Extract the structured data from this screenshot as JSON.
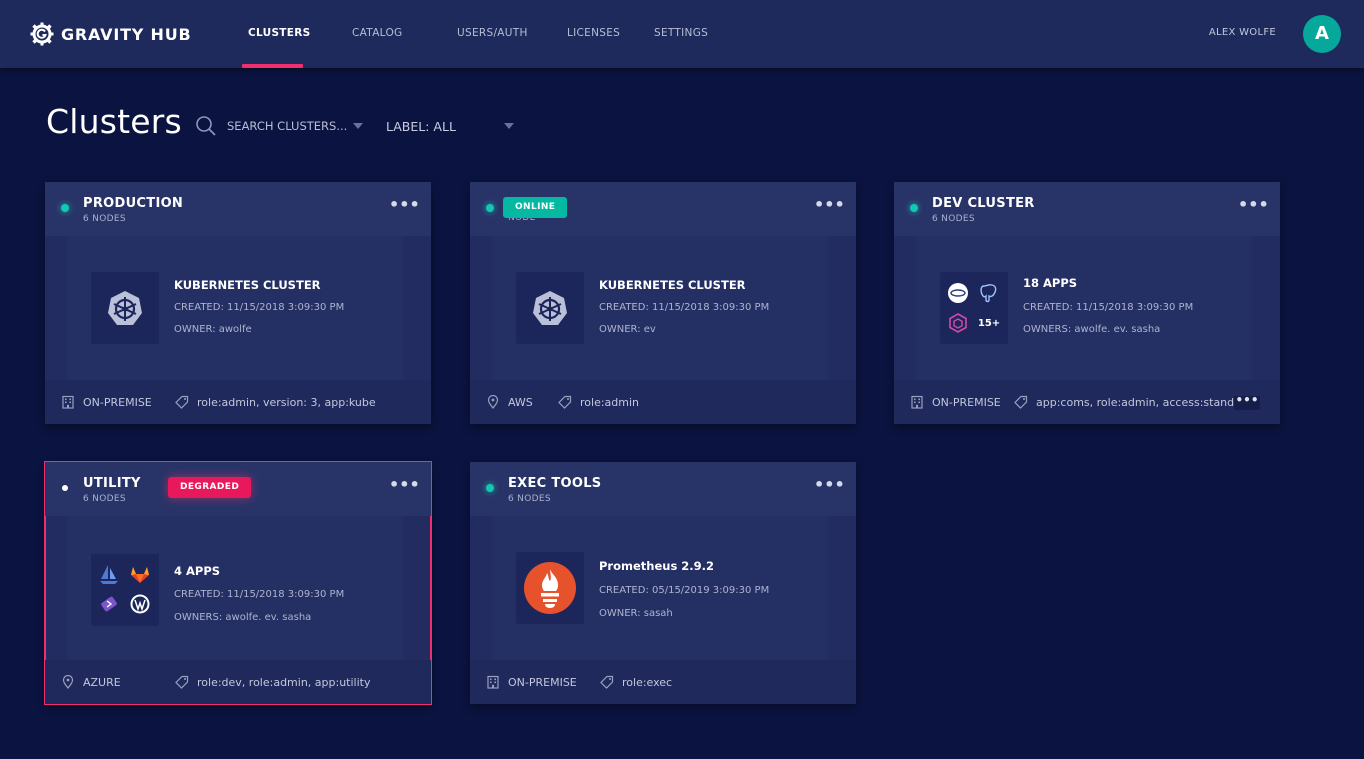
{
  "app": {
    "name": "GRAVITY HUB",
    "logo_icon": "gravity-gear-icon"
  },
  "nav": {
    "items": [
      {
        "label": "CLUSTERS",
        "active": true
      },
      {
        "label": "CATALOG",
        "active": false
      },
      {
        "label": "USERS/AUTH",
        "active": false
      },
      {
        "label": "LICENSES",
        "active": false
      },
      {
        "label": "SETTINGS",
        "active": false
      }
    ]
  },
  "user": {
    "name": "ALEX WOLFE",
    "initial": "A",
    "avatar_color": "#05a89a"
  },
  "page": {
    "title": "Clusters"
  },
  "search": {
    "placeholder": "SEARCH CLUSTERS..."
  },
  "label_filter": {
    "value": "LABEL: ALL"
  },
  "colors": {
    "accent": "#f0306e",
    "online": "#04b8a1",
    "degraded": "#e8185c",
    "background": "#0b1440",
    "card": "#222c60"
  },
  "clusters": [
    {
      "name": "PRODUCTION",
      "nodes": "6 NODES",
      "status": "online",
      "badge": "",
      "title": "KUBERNETES CLUSTER",
      "created": "CREATED: 11/15/2018 3:09:30 PM",
      "owner": "OWNER: awolfe",
      "location_icon": "building-icon",
      "location": "ON-PREMISE",
      "labels": "role:admin, version: 3, app:kube"
    },
    {
      "name": "",
      "nodes": "NODE",
      "status": "online",
      "badge": "ONLINE",
      "title": "KUBERNETES CLUSTER",
      "created": "CREATED: 11/15/2018 3:09:30 PM",
      "owner": "OWNER: ev",
      "location_icon": "map-pin-icon",
      "location": "AWS",
      "labels": "role:admin"
    },
    {
      "name": "DEV CLUSTER",
      "nodes": "6 NODES",
      "status": "online",
      "badge": "",
      "title": "18 APPS",
      "created": "CREATED: 11/15/2018 3:09:30 PM",
      "owner": "OWNERS: awolfe. ev. sasha",
      "apps_more": "15+",
      "location_icon": "building-icon",
      "location": "ON-PREMISE",
      "labels": "app:coms, role:admin, access:standard,",
      "labels_more": "•••"
    },
    {
      "name": "UTILITY",
      "nodes": "6 NODES",
      "status": "degraded",
      "badge": "DEGRADED",
      "title": "4 APPS",
      "created": "CREATED: 11/15/2018 3:09:30 PM",
      "owner": "OWNERS: awolfe. ev. sasha",
      "location_icon": "map-pin-icon",
      "location": "AZURE",
      "labels": "role:dev, role:admin, app:utility"
    },
    {
      "name": "EXEC TOOLS",
      "nodes": "6 NODES",
      "status": "online",
      "badge": "",
      "title": "Prometheus 2.9.2",
      "created": "CREATED: 05/15/2019 3:09:30 PM",
      "owner": "OWNER: sasah",
      "location_icon": "building-icon",
      "location": "ON-PREMISE",
      "labels": "role:exec"
    }
  ]
}
